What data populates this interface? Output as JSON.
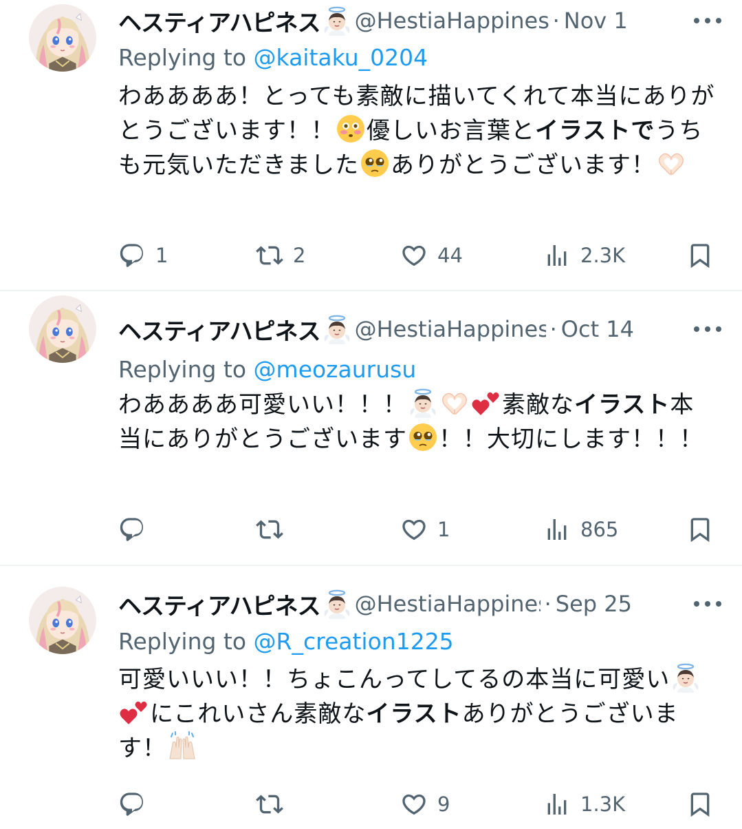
{
  "tweets": [
    {
      "display_name": "ヘスティアハピネス",
      "handle": "@HestiaHappiness",
      "separator": "·",
      "date": "Nov 1",
      "replying_label": "Replying to",
      "replying_to": "@kaitaku_0204",
      "body": [
        {
          "t": "わああああ！とっても素敵に描いてくれて本当にありがとうございます！！"
        },
        {
          "e": "flushed-face-emoji"
        },
        {
          "t": "優しいお言葉と"
        },
        {
          "b": "イラスト"
        },
        {
          "b": "で"
        },
        {
          "t": "うちも元気いただきました"
        },
        {
          "e": "pleading-face-emoji"
        },
        {
          "t": "ありがとうございます！"
        },
        {
          "e": "heart-hands-emoji"
        }
      ],
      "replies": "1",
      "retweets": "2",
      "likes": "44",
      "views": "2.3K"
    },
    {
      "display_name": "ヘスティアハピネス",
      "handle": "@HestiaHappiness",
      "separator": "·",
      "date": "Oct 14",
      "replying_label": "Replying to",
      "replying_to": "@meozaurusu",
      "body": [
        {
          "t": "わああああ可愛いい！！！"
        },
        {
          "e": "angel-emoji"
        },
        {
          "e": "heart-hands-emoji"
        },
        {
          "e": "two-hearts-emoji"
        },
        {
          "t": "素敵な"
        },
        {
          "b": "イラスト"
        },
        {
          "t": "本当にありがとうございます"
        },
        {
          "e": "pleading-face-emoji"
        },
        {
          "t": "！！大切にします！！！"
        }
      ],
      "replies": "",
      "retweets": "",
      "likes": "1",
      "views": "865"
    },
    {
      "display_name": "ヘスティアハピネス",
      "handle": "@HestiaHappiness",
      "separator": "·",
      "date": "Sep 25",
      "replying_label": "Replying to",
      "replying_to": "@R_creation1225",
      "body": [
        {
          "t": "可愛いいい！！ちょこんってしてるの本当に可愛い"
        },
        {
          "e": "angel-emoji"
        },
        {
          "e": "two-hearts-emoji"
        },
        {
          "t": "にこれいさん素敵な"
        },
        {
          "b": "イラスト"
        },
        {
          "t": "ありがとうございます！"
        },
        {
          "e": "raising-hands-emoji"
        }
      ],
      "replies": "",
      "retweets": "",
      "likes": "9",
      "views": "1.3K"
    }
  ],
  "icons": {
    "reply": "reply-icon",
    "retweet": "retweet-icon",
    "like": "heart-icon",
    "views": "views-chart-icon",
    "bookmark": "bookmark-icon",
    "more": "more-dots-icon"
  },
  "colors": {
    "link": "#1d9bf0",
    "secondary_text": "#536471",
    "primary_text": "#0f1419",
    "divider": "#eff3f4"
  }
}
